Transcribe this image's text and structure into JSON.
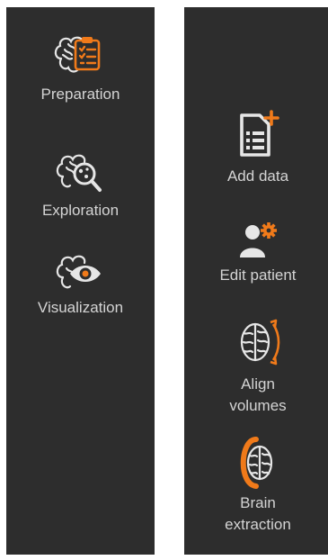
{
  "colors": {
    "panel_bg": "#2d2d2d",
    "text": "#d4d4d4",
    "icon_light": "#e6e6e6",
    "accent": "#f07a1a"
  },
  "left_panel": {
    "items": [
      {
        "label": "Preparation",
        "icon": "brain-clipboard-icon"
      },
      {
        "label": "Exploration",
        "icon": "brain-magnifier-icon"
      },
      {
        "label": "Visualization",
        "icon": "brain-eye-icon"
      }
    ]
  },
  "right_panel": {
    "items": [
      {
        "label": "Add data",
        "icon": "add-document-icon"
      },
      {
        "label": "Edit patient",
        "icon": "user-gear-icon"
      },
      {
        "label": "Align\nvolumes",
        "icon": "brain-rotate-icon"
      },
      {
        "label": "Brain\nextraction",
        "icon": "brain-extraction-icon"
      }
    ]
  }
}
